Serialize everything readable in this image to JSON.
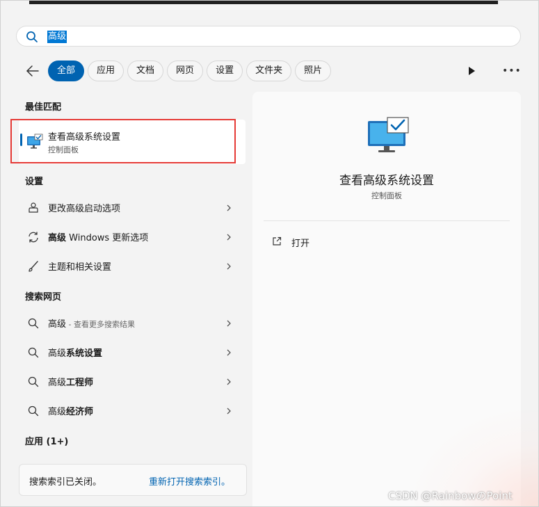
{
  "search": {
    "query": "高级"
  },
  "filters": [
    {
      "label": "全部",
      "active": true
    },
    {
      "label": "应用",
      "active": false
    },
    {
      "label": "文档",
      "active": false
    },
    {
      "label": "网页",
      "active": false
    },
    {
      "label": "设置",
      "active": false
    },
    {
      "label": "文件夹",
      "active": false
    },
    {
      "label": "照片",
      "active": false
    }
  ],
  "best_match": {
    "heading": "最佳匹配",
    "title": "查看高级系统设置",
    "subtitle": "控制面板",
    "icon": "system-settings-monitor-icon"
  },
  "settings": {
    "heading": "设置",
    "items": [
      {
        "bold": "",
        "text": "更改高级启动选项",
        "icon": "startup-icon"
      },
      {
        "bold": "高级",
        "text": " Windows 更新选项",
        "icon": "update-refresh-icon"
      },
      {
        "bold": "",
        "text": "主题和相关设置",
        "icon": "brush-icon"
      }
    ]
  },
  "web": {
    "heading": "搜索网页",
    "items": [
      {
        "bold": "高级",
        "text": "",
        "suffix": " - 查看更多搜索结果",
        "icon": "search-icon"
      },
      {
        "bold": "高级",
        "text": "系统设置",
        "suffix": "",
        "icon": "search-icon"
      },
      {
        "bold": "高级",
        "text": "工程师",
        "suffix": "",
        "icon": "search-icon"
      },
      {
        "bold": "高级",
        "text": "经济师",
        "suffix": "",
        "icon": "search-icon"
      }
    ]
  },
  "apps": {
    "heading": "应用 (1+)"
  },
  "index_notice": {
    "text": "搜索索引已关闭。",
    "link": "重新打开搜索索引。"
  },
  "detail": {
    "title": "查看高级系统设置",
    "subtitle": "控制面板",
    "action_open": "打开"
  },
  "watermark": "CSDN @RainbowのPoint",
  "colors": {
    "accent": "#0063b1",
    "highlight_border": "#e53935",
    "selection": "#0078d4"
  }
}
